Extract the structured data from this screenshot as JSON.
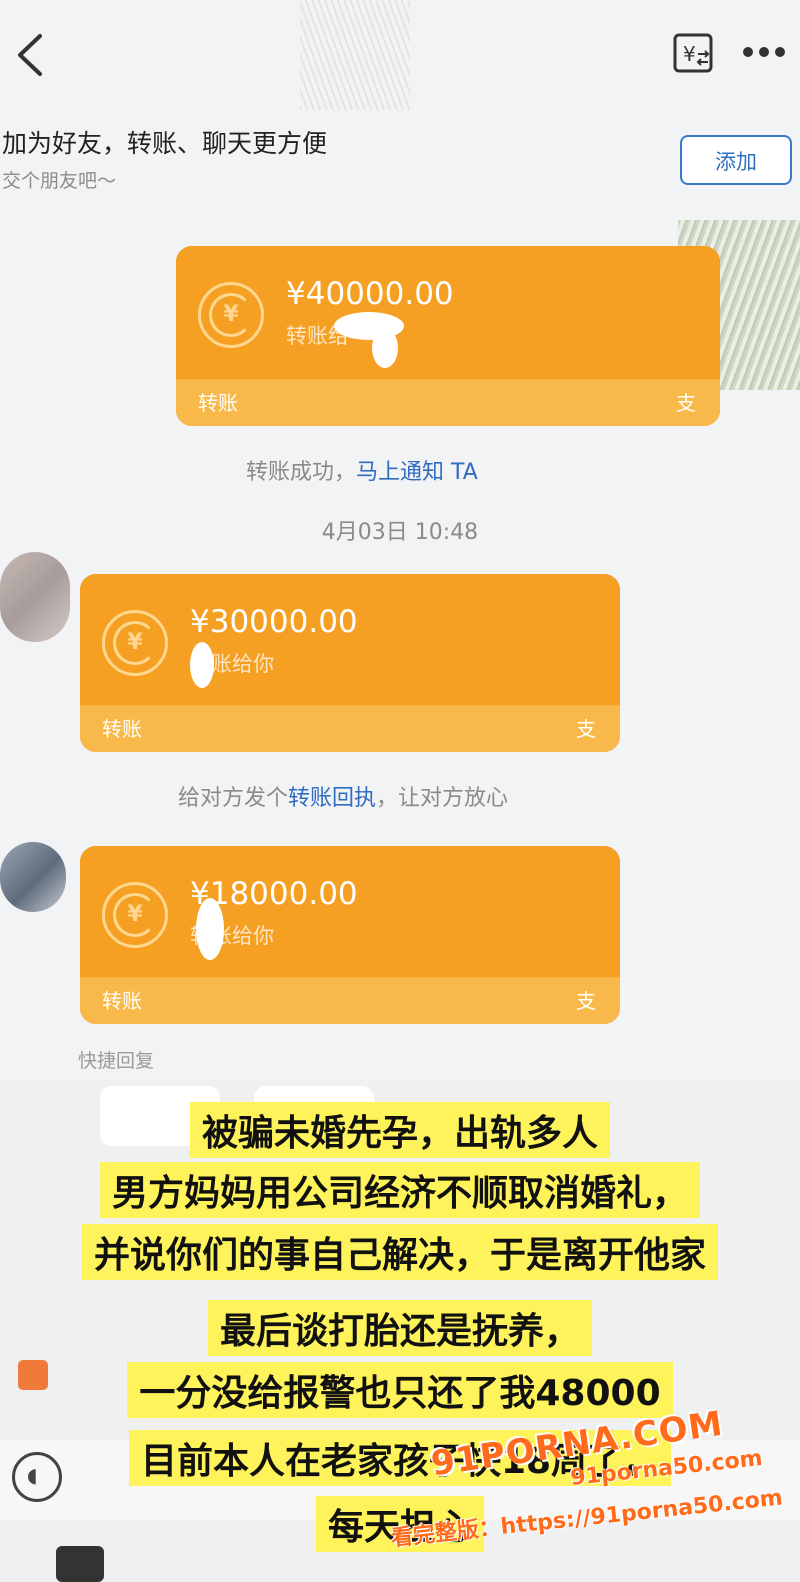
{
  "header": {
    "back_icon": "chevron-left-icon",
    "transfer_icon": "rmb-transfer-icon",
    "more_icon": "more-dots-icon"
  },
  "friend_banner": {
    "title": "加为好友，转账、聊天更方便",
    "subtitle": "交个朋友吧～",
    "add_label": "添加"
  },
  "messages": [
    {
      "amount": "¥40000.00",
      "note": "转账给",
      "type_label": "转账",
      "brand": "支"
    },
    {
      "amount": "¥30000.00",
      "note": "转账给你",
      "type_label": "转账",
      "brand": "支"
    },
    {
      "amount": "¥18000.00",
      "note": "转账给你",
      "type_label": "转账",
      "brand": "支"
    }
  ],
  "system": {
    "success_prefix": "转账成功，",
    "success_link": "马上通知 TA",
    "timestamp": "4月03日 10:48",
    "receipt_prefix": "给对方发个",
    "receipt_link": "转账回执",
    "receipt_suffix": "，让对方放心",
    "quick_reply": "快捷回复"
  },
  "caption": {
    "line1": "被骗未婚先孕，出轨多人",
    "line2": "男方妈妈用公司经济不顺取消婚礼，",
    "line3": "并说你们的事自己解决，于是离开他家",
    "line4": "最后谈打胎还是抚养，",
    "line5": "一分没给报警也只还了我48000",
    "line6": "目前本人在老家孩子快18周了，",
    "line7": "每天担心"
  },
  "watermark": {
    "brand": "91PORNA.COM",
    "label": "看完整版：https://91porna50.com",
    "domain": "91porna50.com"
  },
  "colors": {
    "card_orange": "#f5a023",
    "link_blue": "#2f6cc0",
    "caption_yellow": "#fff35b",
    "watermark_orange": "#ff6b1a"
  }
}
